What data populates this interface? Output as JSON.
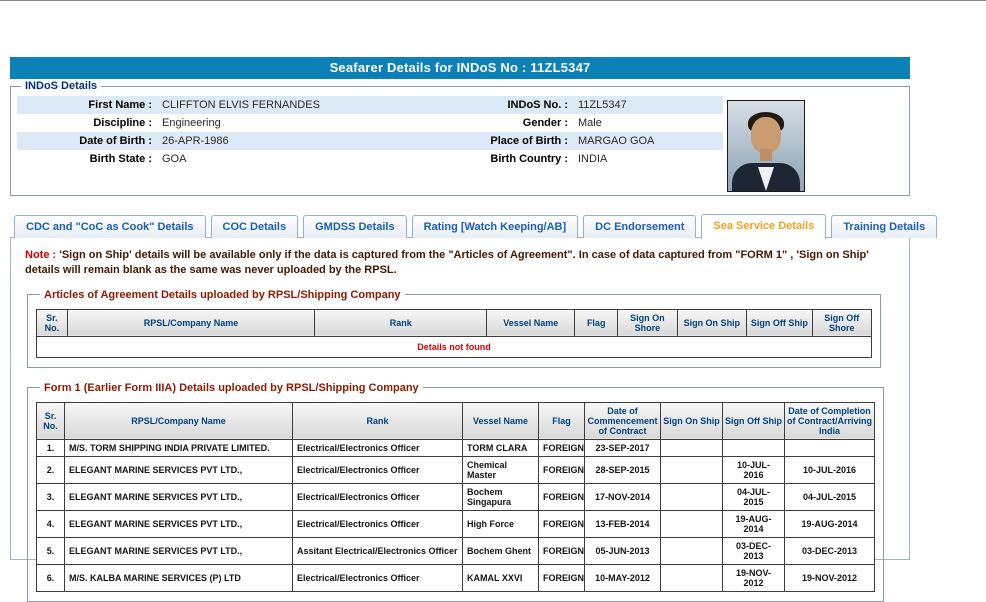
{
  "header": {
    "title": "Seafarer Details for INDoS No : 11ZL5347"
  },
  "colors": {
    "title_bar": "#0c81b7",
    "active_tab_text": "#f0a11e",
    "tab_text": "#1b5fae",
    "note_red": "#cc0000",
    "alt_row": "#dce9f7",
    "legend_maroon": "#8b1a00",
    "header_text_blue": "#00417e"
  },
  "indos": {
    "legend": "INDoS Details",
    "rows": [
      {
        "l1": "First Name :",
        "v1": "CLIFFTON ELVIS FERNANDES",
        "l2": "INDoS No. :",
        "v2": "11ZL5347"
      },
      {
        "l1": "Discipline :",
        "v1": "Engineering",
        "l2": "Gender :",
        "v2": "Male"
      },
      {
        "l1": "Date of Birth :",
        "v1": "26-APR-1986",
        "l2": "Place of Birth :",
        "v2": "MARGAO GOA"
      },
      {
        "l1": "Birth State :",
        "v1": "GOA",
        "l2": "Birth Country :",
        "v2": "INDIA"
      }
    ],
    "photo_alt": "seafarer-photograph"
  },
  "tabs": [
    {
      "label": "CDC and \"CoC as Cook\" Details",
      "active": false
    },
    {
      "label": "COC Details",
      "active": false
    },
    {
      "label": "GMDSS Details",
      "active": false
    },
    {
      "label": "Rating [Watch Keeping/AB]",
      "active": false
    },
    {
      "label": "DC Endorsement",
      "active": false
    },
    {
      "label": "Sea Service Details",
      "active": true
    },
    {
      "label": "Training Details",
      "active": false
    }
  ],
  "note": {
    "prefix": "Note :",
    "text": "'Sign on Ship' details will be available only if the data is captured from the \"Articles of Agreement\". In case of data captured from \"FORM 1\" , 'Sign on Ship' details will remain blank as the same was never uploaded by the RPSL."
  },
  "articles": {
    "legend": "Articles of Agreement Details uploaded by RPSL/Shipping Company",
    "headers": [
      "Sr. No.",
      "RPSL/Company Name",
      "Rank",
      "Vessel Name",
      "Flag",
      "Sign On Shore",
      "Sign On Ship",
      "Sign Off Ship",
      "Sign Off Shore"
    ],
    "empty_message": "Details not found"
  },
  "form1": {
    "legend": "Form 1 (Earlier Form IIIA) Details uploaded by RPSL/Shipping Company",
    "headers": [
      "Sr. No.",
      "RPSL/Company Name",
      "Rank",
      "Vessel Name",
      "Flag",
      "Date of Commencement of Contract",
      "Sign On Ship",
      "Sign Off Ship",
      "Date of Completion of Contract/Arriving India"
    ],
    "rows": [
      {
        "sr": "1.",
        "company": "M/S. TORM SHIPPING INDIA PRIVATE LIMITED.",
        "rank": "Electrical/Electronics Officer",
        "vessel": "TORM CLARA",
        "flag": "FOREIGN",
        "commencement": "23-SEP-2017",
        "sign_on_ship": "",
        "sign_off_ship": "",
        "completion": ""
      },
      {
        "sr": "2.",
        "company": "ELEGANT MARINE SERVICES PVT LTD.,",
        "rank": "Electrical/Electronics Officer",
        "vessel": "Chemical Master",
        "flag": "FOREIGN",
        "commencement": "28-SEP-2015",
        "sign_on_ship": "",
        "sign_off_ship": "10-JUL-2016",
        "completion": "10-JUL-2016"
      },
      {
        "sr": "3.",
        "company": "ELEGANT MARINE SERVICES PVT LTD.,",
        "rank": "Electrical/Electronics Officer",
        "vessel": "Bochem Singapura",
        "flag": "FOREIGN",
        "commencement": "17-NOV-2014",
        "sign_on_ship": "",
        "sign_off_ship": "04-JUL-2015",
        "completion": "04-JUL-2015"
      },
      {
        "sr": "4.",
        "company": "ELEGANT MARINE SERVICES PVT LTD.,",
        "rank": "Electrical/Electronics Officer",
        "vessel": "High Force",
        "flag": "FOREIGN",
        "commencement": "13-FEB-2014",
        "sign_on_ship": "",
        "sign_off_ship": "19-AUG-2014",
        "completion": "19-AUG-2014"
      },
      {
        "sr": "5.",
        "company": "ELEGANT MARINE SERVICES PVT LTD.,",
        "rank": "Assitant Electrical/Electronics Officer",
        "vessel": "Bochem Ghent",
        "flag": "FOREIGN",
        "commencement": "05-JUN-2013",
        "sign_on_ship": "",
        "sign_off_ship": "03-DEC-2013",
        "completion": "03-DEC-2013"
      },
      {
        "sr": "6.",
        "company": "M/S. KALBA MARINE SERVICES (P) LTD",
        "rank": "Electrical/Electronics Officer",
        "vessel": "KAMAL XXVI",
        "flag": "FOREIGN",
        "commencement": "10-MAY-2012",
        "sign_on_ship": "",
        "sign_off_ship": "19-NOV-2012",
        "completion": "19-NOV-2012"
      }
    ]
  }
}
